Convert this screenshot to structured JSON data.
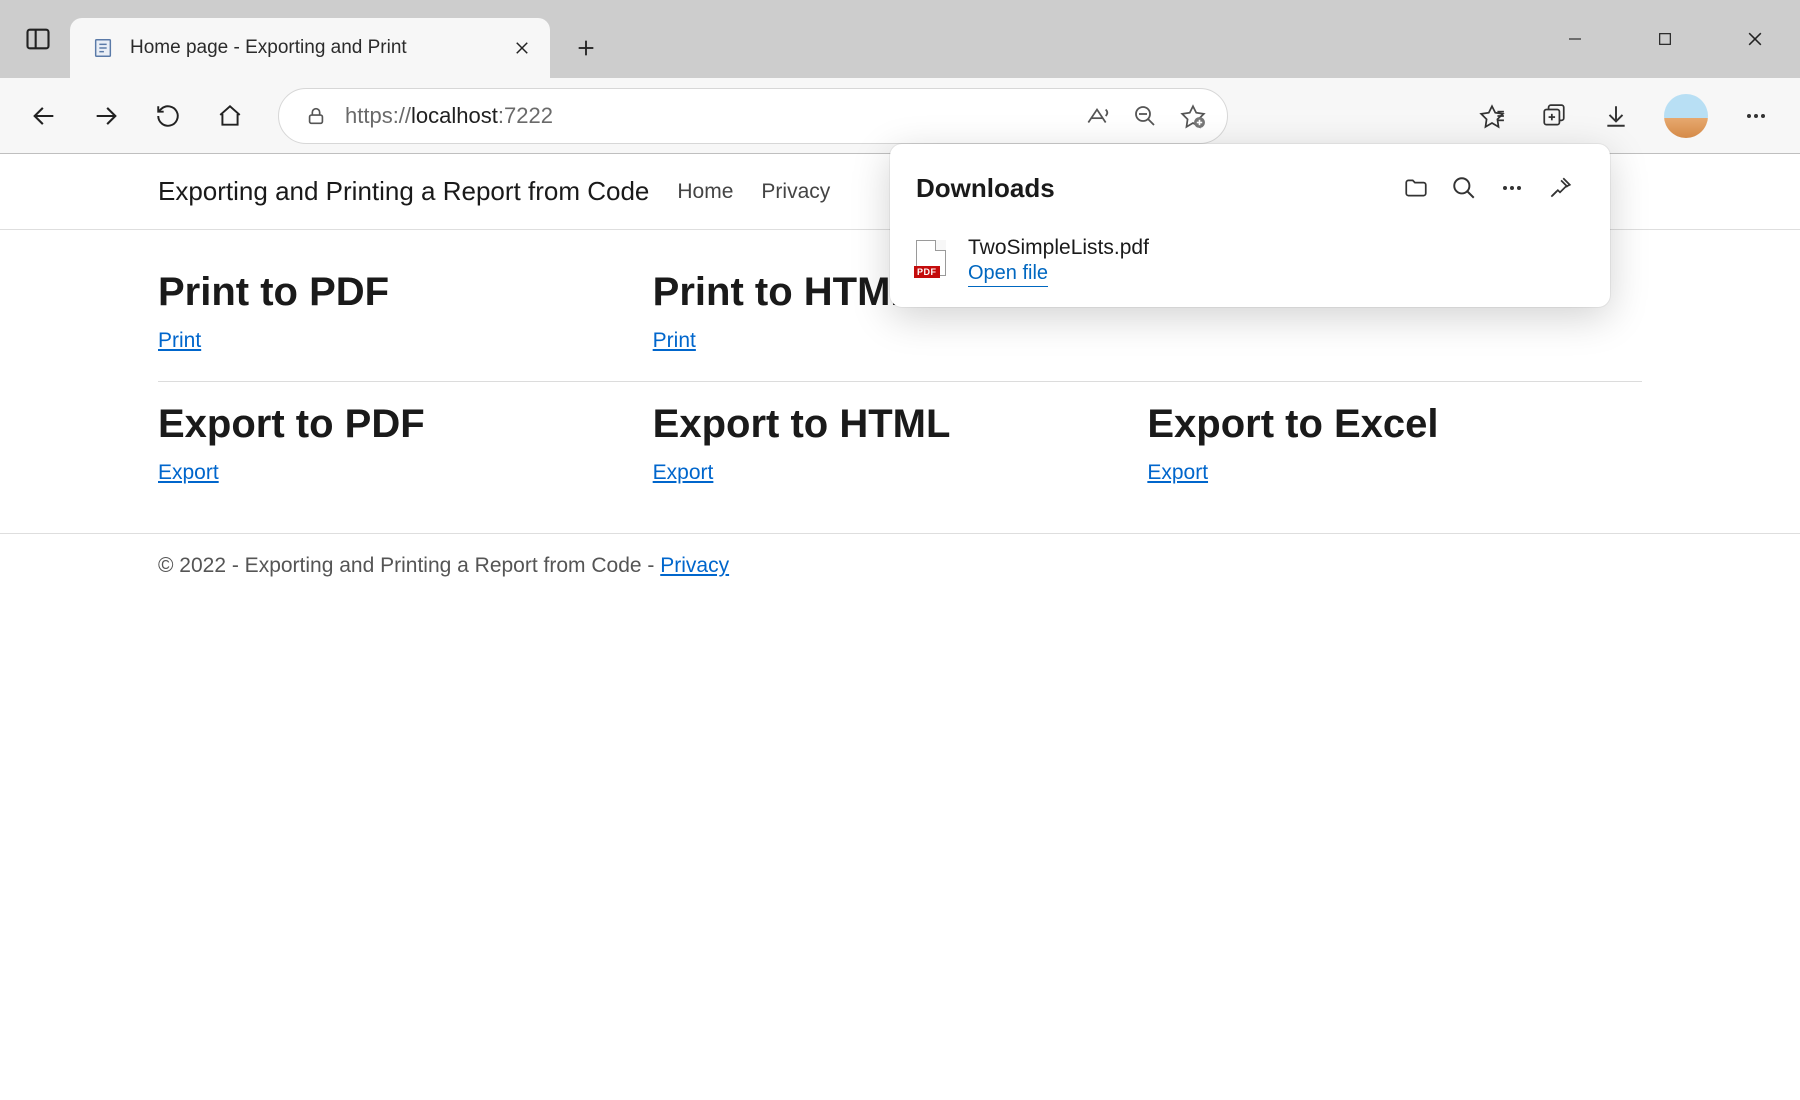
{
  "browser": {
    "tab_title": "Home page - Exporting and Print",
    "url_scheme": "https://",
    "url_host": "localhost",
    "url_port": ":7222"
  },
  "site": {
    "title": "Exporting and Printing a Report from Code",
    "nav": {
      "home": "Home",
      "privacy": "Privacy"
    }
  },
  "sections": {
    "print_pdf": {
      "heading": "Print to PDF",
      "link": "Print"
    },
    "print_html": {
      "heading": "Print to HTML",
      "link": "Print"
    },
    "export_pdf": {
      "heading": "Export to PDF",
      "link": "Export"
    },
    "export_html": {
      "heading": "Export to HTML",
      "link": "Export"
    },
    "export_excel": {
      "heading": "Export to Excel",
      "link": "Export"
    }
  },
  "footer": {
    "text": "© 2022 - Exporting and Printing a Report from Code - ",
    "privacy": "Privacy"
  },
  "downloads": {
    "title": "Downloads",
    "file_badge": "PDF",
    "filename": "TwoSimpleLists.pdf",
    "open": "Open file"
  }
}
